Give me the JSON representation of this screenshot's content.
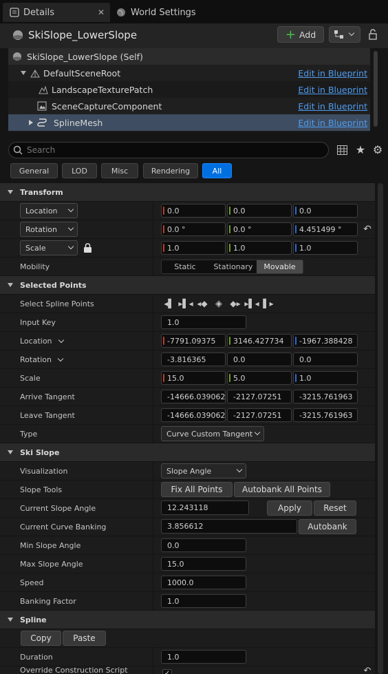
{
  "tabs": [
    {
      "label": "Details"
    },
    {
      "label": "World Settings"
    }
  ],
  "actor": {
    "name": "SkiSlope_LowerSlope",
    "add_label": "Add"
  },
  "tree": {
    "items": [
      {
        "label": "SkiSlope_LowerSlope (Self)",
        "link": ""
      },
      {
        "label": "DefaultSceneRoot",
        "link": "Edit in Blueprint"
      },
      {
        "label": "LandscapeTexturePatch",
        "link": "Edit in Blueprint"
      },
      {
        "label": "SceneCaptureComponent",
        "link": "Edit in Blueprint"
      },
      {
        "label": "SplineMesh",
        "link": "Edit in Blueprint"
      }
    ]
  },
  "search": {
    "placeholder": "Search"
  },
  "filters": [
    "General",
    "LOD",
    "Misc",
    "Rendering",
    "All"
  ],
  "transform": {
    "title": "Transform",
    "location": {
      "label": "Location",
      "x": "0.0",
      "y": "0.0",
      "z": "0.0"
    },
    "rotation": {
      "label": "Rotation",
      "x": "0.0 °",
      "y": "0.0 °",
      "z": "4.451499 °"
    },
    "scale": {
      "label": "Scale",
      "x": "1.0",
      "y": "1.0",
      "z": "1.0"
    },
    "mobility": {
      "label": "Mobility",
      "options": [
        "Static",
        "Stationary",
        "Movable"
      ],
      "selected": "Movable"
    }
  },
  "selected_points": {
    "title": "Selected Points",
    "select_label": "Select Spline Points",
    "input_key": {
      "label": "Input Key",
      "value": "1.0"
    },
    "location": {
      "label": "Location",
      "x": "-7791.09375",
      "y": "3146.427734",
      "z": "-1967.388428"
    },
    "rotation": {
      "label": "Rotation",
      "x": "-3.816365",
      "y": "0.0",
      "z": "0.0"
    },
    "scale": {
      "label": "Scale",
      "x": "15.0",
      "y": "5.0",
      "z": "1.0"
    },
    "arrive": {
      "label": "Arrive Tangent",
      "x": "-14666.039062",
      "y": "-2127.07251",
      "z": "-3215.761963"
    },
    "leave": {
      "label": "Leave Tangent",
      "x": "-14666.039062",
      "y": "-2127.07251",
      "z": "-3215.761963"
    },
    "type": {
      "label": "Type",
      "value": "Curve Custom Tangent"
    }
  },
  "ski_slope": {
    "title": "Ski Slope",
    "visualization": {
      "label": "Visualization",
      "value": "Slope Angle"
    },
    "slope_tools": {
      "label": "Slope Tools",
      "fix": "Fix All Points",
      "autobank": "Autobank All Points"
    },
    "current_angle": {
      "label": "Current Slope Angle",
      "value": "12.243118",
      "apply": "Apply",
      "reset": "Reset"
    },
    "current_banking": {
      "label": "Current Curve Banking",
      "value": "3.856612",
      "autobank": "Autobank"
    },
    "min_angle": {
      "label": "Min Slope Angle",
      "value": "0.0"
    },
    "max_angle": {
      "label": "Max Slope Angle",
      "value": "15.0"
    },
    "speed": {
      "label": "Speed",
      "value": "1000.0"
    },
    "banking": {
      "label": "Banking Factor",
      "value": "1.0"
    }
  },
  "spline": {
    "title": "Spline",
    "copy": "Copy",
    "paste": "Paste",
    "duration": {
      "label": "Duration",
      "value": "1.0"
    },
    "override": {
      "label": "Override Construction Script"
    }
  },
  "colors": {
    "x_axis": "#c0392b",
    "y_axis": "#6f9c1e",
    "z_axis": "#2e68d6",
    "accent": "#0070e0",
    "link": "#4f9cf0"
  }
}
